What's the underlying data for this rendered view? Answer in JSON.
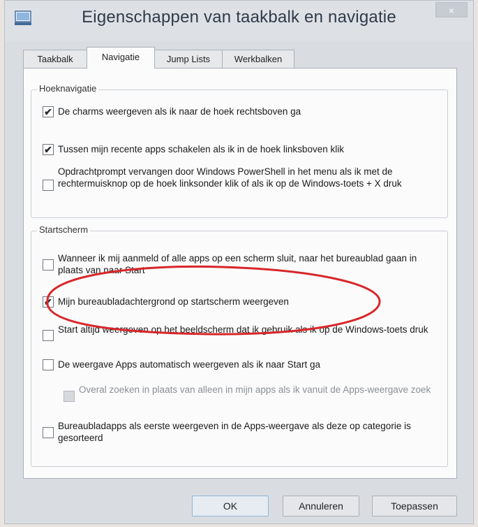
{
  "window": {
    "title": "Eigenschappen van taakbalk en navigatie",
    "close_glyph": "×"
  },
  "tabs": [
    {
      "label": "Taakbalk"
    },
    {
      "label": "Navigatie"
    },
    {
      "label": "Jump Lists"
    },
    {
      "label": "Werkbalken"
    }
  ],
  "active_tab": "Navigatie",
  "corner_navigation": {
    "legend": "Hoeknavigatie",
    "options": [
      {
        "label": "De charms weergeven als ik naar de hoek rechtsboven ga",
        "checked": true,
        "enabled": true
      },
      {
        "label": "Tussen mijn recente apps schakelen als ik in de hoek linksboven klik",
        "checked": true,
        "enabled": true
      },
      {
        "label": "Opdrachtprompt vervangen door Windows PowerShell in het menu als ik met de rechtermuisknop op de hoek linksonder klik of als ik op de Windows-toets + X druk",
        "checked": false,
        "enabled": true
      }
    ]
  },
  "start_screen": {
    "legend": "Startscherm",
    "options": [
      {
        "label": "Wanneer ik mij aanmeld of alle apps op een scherm sluit, naar het bureaublad gaan in plaats van naar Start",
        "checked": false,
        "enabled": true
      },
      {
        "label": "Mijn bureaubladachtergrond op startscherm weergeven",
        "checked": true,
        "enabled": true
      },
      {
        "label": "Start altijd weergeven op het beeldscherm dat ik gebruik als ik op de Windows-toets druk",
        "checked": false,
        "enabled": true
      },
      {
        "label": "De weergave Apps automatisch weergeven als ik naar Start ga",
        "checked": false,
        "enabled": true
      },
      {
        "label": "Overal zoeken in plaats van alleen in mijn apps als ik vanuit de Apps-weergave zoek",
        "checked": false,
        "enabled": false
      },
      {
        "label": "Bureaubladapps als eerste weergeven in de Apps-weergave als deze op categorie is gesorteerd",
        "checked": false,
        "enabled": true
      }
    ]
  },
  "buttons": {
    "ok": "OK",
    "cancel": "Annuleren",
    "apply": "Toepassen"
  },
  "check_glyph": "✔",
  "colors": {
    "annotation_ellipse": "#d8262a",
    "title_text": "#303a48",
    "panel_background": "#fbfbfb"
  }
}
